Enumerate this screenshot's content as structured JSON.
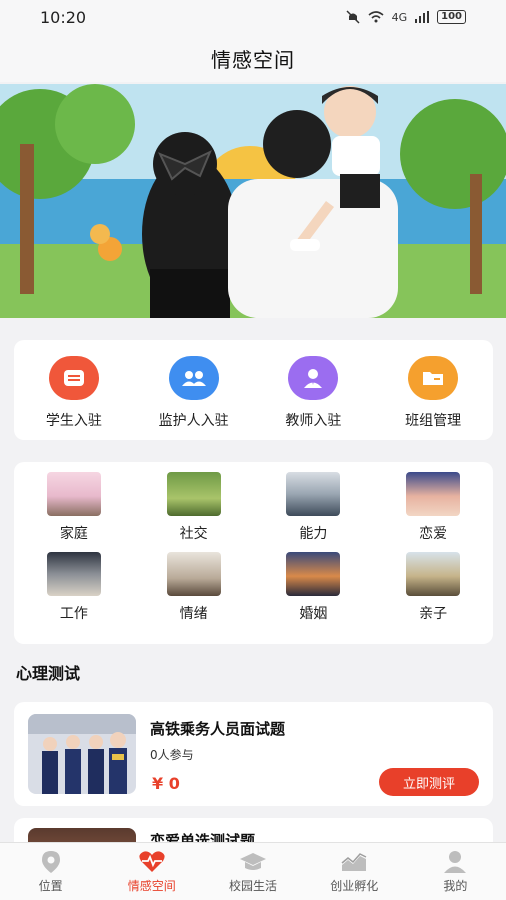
{
  "status_bar": {
    "time": "10:20",
    "battery": "100",
    "network": "4G"
  },
  "header": {
    "title": "情感空间"
  },
  "entries": [
    {
      "label": "学生入驻",
      "color": "#f0573a",
      "icon": "chat-card-icon"
    },
    {
      "label": "监护人入驻",
      "color": "#3f8ef0",
      "icon": "group-users-icon"
    },
    {
      "label": "教师入驻",
      "color": "#9b6df0",
      "icon": "teacher-icon"
    },
    {
      "label": "班组管理",
      "color": "#f5a02e",
      "icon": "folder-icon"
    }
  ],
  "categories": [
    {
      "label": "家庭"
    },
    {
      "label": "社交"
    },
    {
      "label": "能力"
    },
    {
      "label": "恋爱"
    },
    {
      "label": "工作"
    },
    {
      "label": "情绪"
    },
    {
      "label": "婚姻"
    },
    {
      "label": "亲子"
    }
  ],
  "section": {
    "title": "心理测试"
  },
  "tests": [
    {
      "title": "高铁乘务人员面试题",
      "participants": "0人参与",
      "price": "¥ 0",
      "button": "立即测评"
    },
    {
      "title": "恋爱单选测试题"
    }
  ],
  "tabbar": [
    {
      "label": "位置",
      "icon": "location-icon",
      "active": false
    },
    {
      "label": "情感空间",
      "icon": "heart-pulse-icon",
      "active": true
    },
    {
      "label": "校园生活",
      "icon": "graduation-cap-icon",
      "active": false
    },
    {
      "label": "创业孵化",
      "icon": "trend-chart-icon",
      "active": false
    },
    {
      "label": "我的",
      "icon": "user-icon",
      "active": false
    }
  ],
  "colors": {
    "accent": "#e8402a",
    "background": "#f2f2f4"
  }
}
